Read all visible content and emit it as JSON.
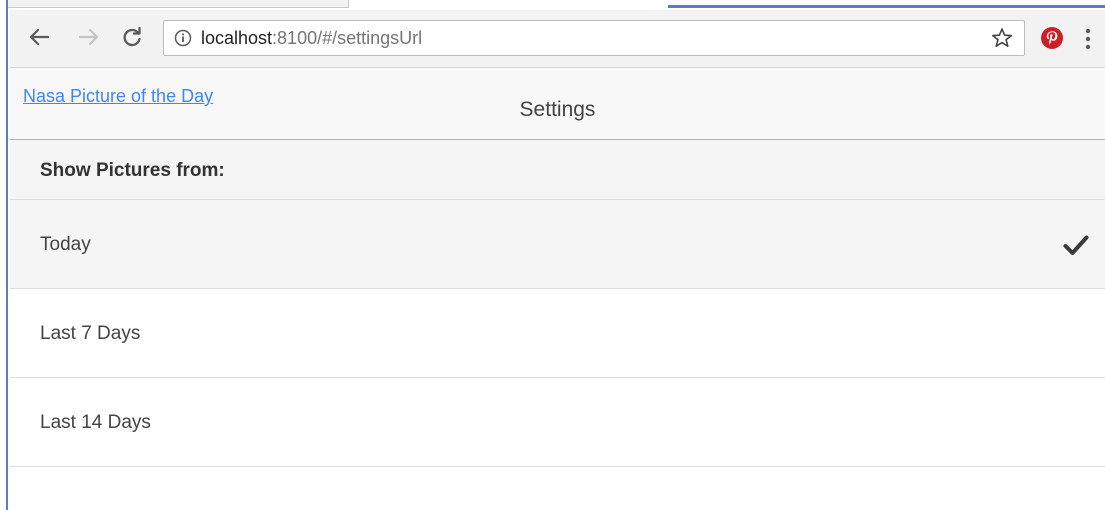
{
  "browser": {
    "url_host": "localhost",
    "url_rest": ":8100/#/settingsUrl",
    "icons": {
      "back": "back-arrow-icon",
      "forward": "forward-arrow-icon",
      "reload": "reload-icon",
      "info": "info-icon",
      "bookmark": "star-icon",
      "extension": "pinterest-icon",
      "menu": "menu-dots-icon"
    }
  },
  "header": {
    "back_link": "Nasa Picture of the Day",
    "title": "Settings"
  },
  "settings": {
    "section_label": "Show Pictures from:",
    "options": [
      {
        "label": "Today",
        "selected": true
      },
      {
        "label": "Last 7 Days",
        "selected": false
      },
      {
        "label": "Last 14 Days",
        "selected": false
      }
    ]
  },
  "colors": {
    "link": "#3d86ff",
    "pinterest": "#cb2027",
    "accent_border": "#5a7fbf"
  }
}
